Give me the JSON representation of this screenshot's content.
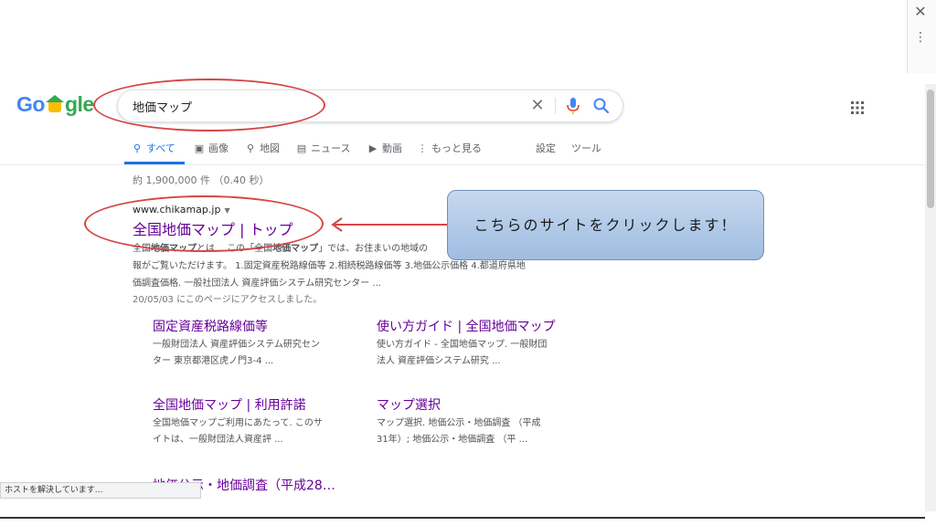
{
  "window": {
    "close_glyph": "✕",
    "menu_glyph": "⋮"
  },
  "logo": {
    "text_before": "Go",
    "text_after": "gle"
  },
  "search": {
    "query": "地価マップ",
    "clear_icon": "clear-icon",
    "mic_icon": "mic-icon",
    "search_icon": "search-icon"
  },
  "tabs": [
    {
      "icon": "search-icon",
      "label": "すべて"
    },
    {
      "icon": "image-icon",
      "label": "画像"
    },
    {
      "icon": "map-pin-icon",
      "label": "地図"
    },
    {
      "icon": "news-icon",
      "label": "ニュース"
    },
    {
      "icon": "video-icon",
      "label": "動画"
    },
    {
      "icon": "more-icon",
      "label": "もっと見る"
    }
  ],
  "tools": {
    "settings_label": "設定",
    "tools_label": "ツール"
  },
  "result_stats": "約 1,900,000 件 （0.40 秒）",
  "result": {
    "url": "www.chikamap.jp",
    "title": "全国地価マップ | トップ",
    "snippet_parts": [
      "全国",
      "地価マップ",
      "とは… この「全国",
      "地価マップ",
      "」では、お住まいの地域の",
      "報がご覧いただけます。 1.固定資産税路線価等 2.相続税路線価等 3.地価公示価格 4.都道府県地",
      "価調査価格. 一般社団法人 資産評価システム研究センター ..."
    ],
    "visited": "20/05/03 にこのページにアクセスしました。"
  },
  "sitelinks": [
    {
      "title": "固定資産税路線価等",
      "desc": "一般財団法人 資産評価システム研究センター 東京都港区虎ノ門3-4 ..."
    },
    {
      "title": "使い方ガイド | 全国地価マップ",
      "desc": "使い方ガイド - 全国地価マップ. 一般財団法人 資産評価システム研究 ..."
    },
    {
      "title": "全国地価マップ | 利用許諾",
      "desc": "全国地価マップご利用にあたって. このサイトは、一般財団法人資産評 ..."
    },
    {
      "title": "マップ選択",
      "desc": "マップ選択. 地価公示・地価調査 （平成31年）; 地価公示・地価調査 （平 ..."
    }
  ],
  "partial_sitelink": "地価公示・地価調査（平成28…",
  "callout": "こちらのサイトをクリックします！",
  "status_bar": "ホストを解決しています...",
  "colors": {
    "visited_link": "#660099",
    "annotation_red": "#d64545",
    "accent_blue": "#1a73e8"
  }
}
